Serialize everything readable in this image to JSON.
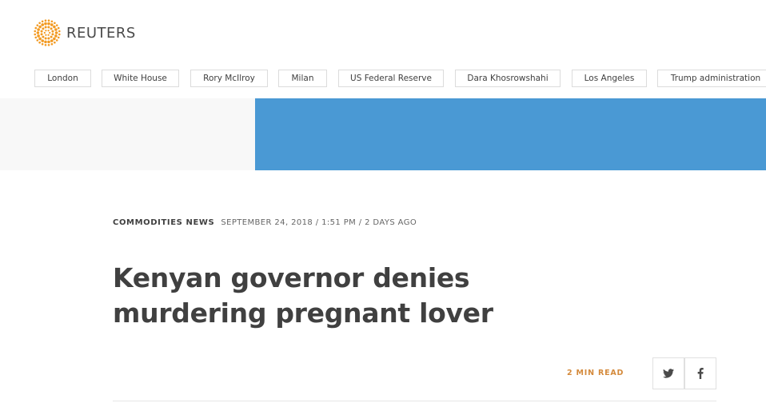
{
  "header": {
    "logo_text": "REUTERS",
    "logo_icon": "reuters-dot-logo-icon",
    "logo_color": "#f29a22"
  },
  "topics": [
    {
      "label": "London"
    },
    {
      "label": "White House"
    },
    {
      "label": "Rory McIlroy"
    },
    {
      "label": "Milan"
    },
    {
      "label": "US Federal Reserve"
    },
    {
      "label": "Dara Khosrowshahi"
    },
    {
      "label": "Los Angeles"
    },
    {
      "label": "Trump administration"
    }
  ],
  "banner": {
    "color": "#4a99d4",
    "left_color": "#f8f8f8"
  },
  "article": {
    "channel": "COMMODITIES NEWS",
    "dateline": "SEPTEMBER 24, 2018 / 1:51 PM / 2 DAYS AGO",
    "headline": "Kenyan governor denies murdering pregnant lover",
    "read_time": "2 MIN READ",
    "read_time_color": "#d48a3c"
  },
  "share": {
    "twitter_icon": "twitter-icon",
    "facebook_icon": "facebook-icon"
  }
}
